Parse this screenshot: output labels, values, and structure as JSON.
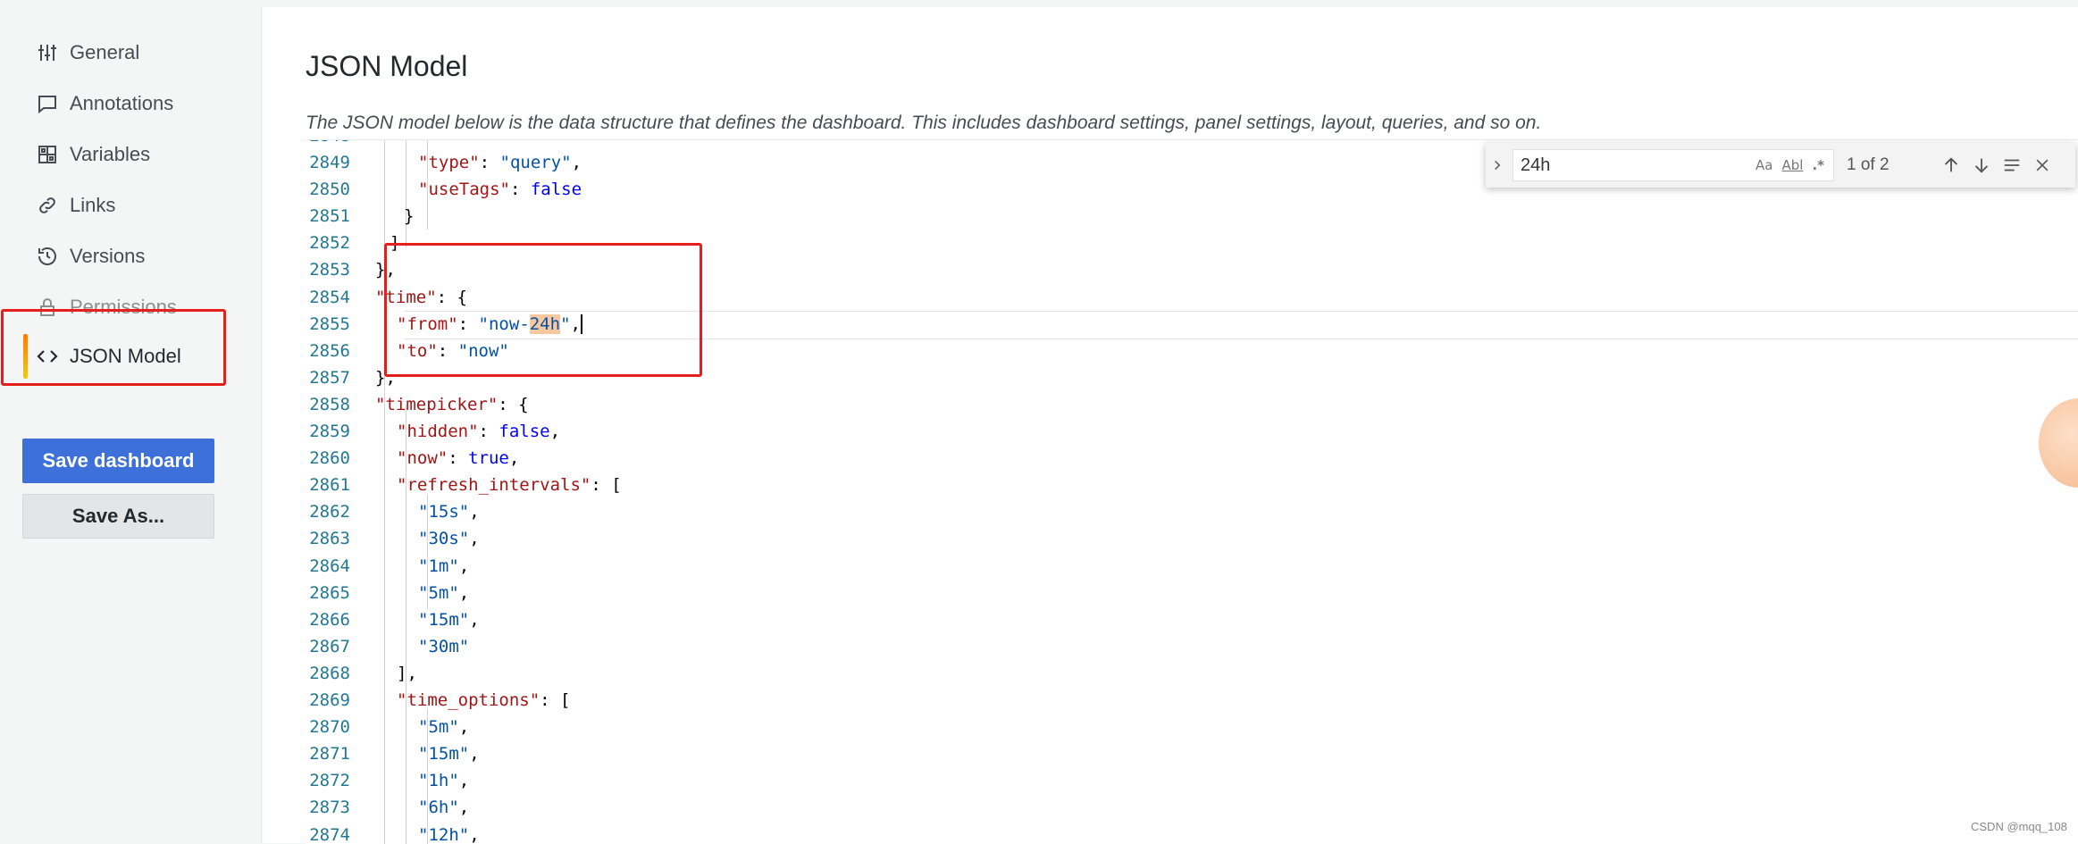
{
  "sidebar": {
    "items": [
      {
        "label": "General",
        "icon": "sliders-icon"
      },
      {
        "label": "Annotations",
        "icon": "comment-icon"
      },
      {
        "label": "Variables",
        "icon": "grid-icon"
      },
      {
        "label": "Links",
        "icon": "link-icon"
      },
      {
        "label": "Versions",
        "icon": "history-icon"
      },
      {
        "label": "Permissions",
        "icon": "lock-icon"
      },
      {
        "label": "JSON Model",
        "icon": "code-icon"
      }
    ],
    "active": "JSON Model",
    "save_dashboard": "Save dashboard",
    "save_as": "Save As..."
  },
  "main": {
    "title": "JSON Model",
    "description": "The JSON model below is the data structure that defines the dashboard. This includes dashboard settings, panel settings, layout, queries, and so on."
  },
  "find": {
    "query": "24h",
    "match_case": "Aa",
    "whole_word": "Abl",
    "regex": ".*",
    "count": "1 of 2"
  },
  "editor": {
    "lines": [
      {
        "n": "2849",
        "parts": [
          [
            "k",
            "\"type\""
          ],
          [
            "p",
            ": "
          ],
          [
            "s",
            "\"query\""
          ],
          [
            "p",
            ","
          ]
        ]
      },
      {
        "n": "2850",
        "parts": [
          [
            "k",
            "\"useTags\""
          ],
          [
            "p",
            ": "
          ],
          [
            "b",
            "false"
          ]
        ]
      },
      {
        "n": "2851",
        "parts": [
          [
            "p",
            "}"
          ]
        ]
      },
      {
        "n": "2852",
        "parts": [
          [
            "p",
            "]"
          ]
        ]
      },
      {
        "n": "2853",
        "parts": [
          [
            "p",
            "},"
          ]
        ]
      },
      {
        "n": "2854",
        "parts": [
          [
            "k",
            "\"time\""
          ],
          [
            "p",
            ": {"
          ]
        ]
      },
      {
        "n": "2855",
        "parts": [
          [
            "k",
            "\"from\""
          ],
          [
            "p",
            ": "
          ],
          [
            "s",
            "\"now-"
          ],
          [
            "h",
            "24h"
          ],
          [
            "s",
            "\""
          ],
          [
            "p",
            ","
          ]
        ]
      },
      {
        "n": "2856",
        "parts": [
          [
            "k",
            "\"to\""
          ],
          [
            "p",
            ": "
          ],
          [
            "s",
            "\"now\""
          ]
        ]
      },
      {
        "n": "2857",
        "parts": [
          [
            "p",
            "},"
          ]
        ]
      },
      {
        "n": "2858",
        "parts": [
          [
            "k",
            "\"timepicker\""
          ],
          [
            "p",
            ": {"
          ]
        ]
      },
      {
        "n": "2859",
        "parts": [
          [
            "k",
            "\"hidden\""
          ],
          [
            "p",
            ": "
          ],
          [
            "b",
            "false"
          ],
          [
            "p",
            ","
          ]
        ]
      },
      {
        "n": "2860",
        "parts": [
          [
            "k",
            "\"now\""
          ],
          [
            "p",
            ": "
          ],
          [
            "b",
            "true"
          ],
          [
            "p",
            ","
          ]
        ]
      },
      {
        "n": "2861",
        "parts": [
          [
            "k",
            "\"refresh_intervals\""
          ],
          [
            "p",
            ": ["
          ]
        ]
      },
      {
        "n": "2862",
        "parts": [
          [
            "s",
            "\"15s\""
          ],
          [
            "p",
            ","
          ]
        ]
      },
      {
        "n": "2863",
        "parts": [
          [
            "s",
            "\"30s\""
          ],
          [
            "p",
            ","
          ]
        ]
      },
      {
        "n": "2864",
        "parts": [
          [
            "s",
            "\"1m\""
          ],
          [
            "p",
            ","
          ]
        ]
      },
      {
        "n": "2865",
        "parts": [
          [
            "s",
            "\"5m\""
          ],
          [
            "p",
            ","
          ]
        ]
      },
      {
        "n": "2866",
        "parts": [
          [
            "s",
            "\"15m\""
          ],
          [
            "p",
            ","
          ]
        ]
      },
      {
        "n": "2867",
        "parts": [
          [
            "s",
            "\"30m\""
          ]
        ]
      },
      {
        "n": "2868",
        "parts": [
          [
            "p",
            "],"
          ]
        ]
      },
      {
        "n": "2869",
        "parts": [
          [
            "k",
            "\"time_options\""
          ],
          [
            "p",
            ": ["
          ]
        ]
      },
      {
        "n": "2870",
        "parts": [
          [
            "s",
            "\"5m\""
          ],
          [
            "p",
            ","
          ]
        ]
      },
      {
        "n": "2871",
        "parts": [
          [
            "s",
            "\"15m\""
          ],
          [
            "p",
            ","
          ]
        ]
      },
      {
        "n": "2872",
        "parts": [
          [
            "s",
            "\"1h\""
          ],
          [
            "p",
            ","
          ]
        ]
      },
      {
        "n": "2873",
        "parts": [
          [
            "s",
            "\"6h\""
          ],
          [
            "p",
            ","
          ]
        ]
      },
      {
        "n": "2874",
        "parts": [
          [
            "s",
            "\"12h\""
          ],
          [
            "p",
            ","
          ]
        ]
      }
    ]
  },
  "watermark": "CSDN @mqq_108"
}
